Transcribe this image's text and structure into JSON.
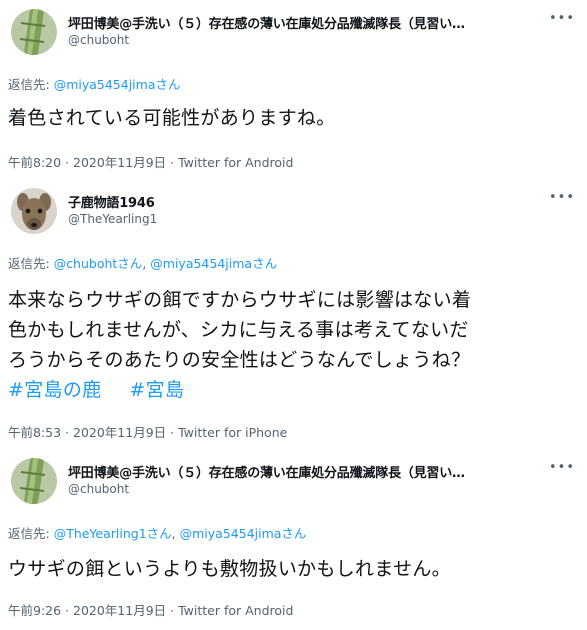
{
  "tweets": [
    {
      "display_name": "坪田博美@手洗い（５）存在感の薄い在庫処分品殲滅隊長（見習い…",
      "handle": "@chuboht",
      "reply_prefix": "返信先: ",
      "reply_to": [
        "@miya5454jimaさん"
      ],
      "reply_sep": "",
      "text": "着色されている可能性がありますね。",
      "time": "午前8:20 · 2020年11月9日",
      "dot": " · ",
      "source": "Twitter for Android"
    },
    {
      "display_name": "子鹿物語1946",
      "handle": "@TheYearling1",
      "reply_prefix": "返信先: ",
      "reply_to": [
        "@chubohtさん",
        "@miya5454jimaさん"
      ],
      "reply_sep": ", ",
      "text_line1": "本来ならウサギの餌ですからウサギには影響はない着",
      "text_line2": "色かもしれませんが、シカに与える事は考えてないだ",
      "text_line3": "ろうからそのあたりの安全性はどうなんでしょうね？",
      "hashtags": [
        "#宮島の鹿",
        "#宮島"
      ],
      "time": "午前8:53 · 2020年11月9日",
      "dot": " · ",
      "source": "Twitter for iPhone"
    },
    {
      "display_name": "坪田博美@手洗い（５）存在感の薄い在庫処分品殲滅隊長（見習い…",
      "handle": "@chuboht",
      "reply_prefix": "返信先: ",
      "reply_to": [
        "@TheYearling1さん",
        "@miya5454jimaさん"
      ],
      "reply_sep": ", ",
      "text": "ウサギの餌というよりも敷物扱いかもしれません。",
      "time": "午前9:26 · 2020年11月9日",
      "dot": " · ",
      "source": "Twitter for Android"
    }
  ],
  "more_icon": "more-horizontal-icon",
  "colors": {
    "link": "#1d9bf0",
    "secondary": "#536471",
    "text": "#0f1419"
  }
}
